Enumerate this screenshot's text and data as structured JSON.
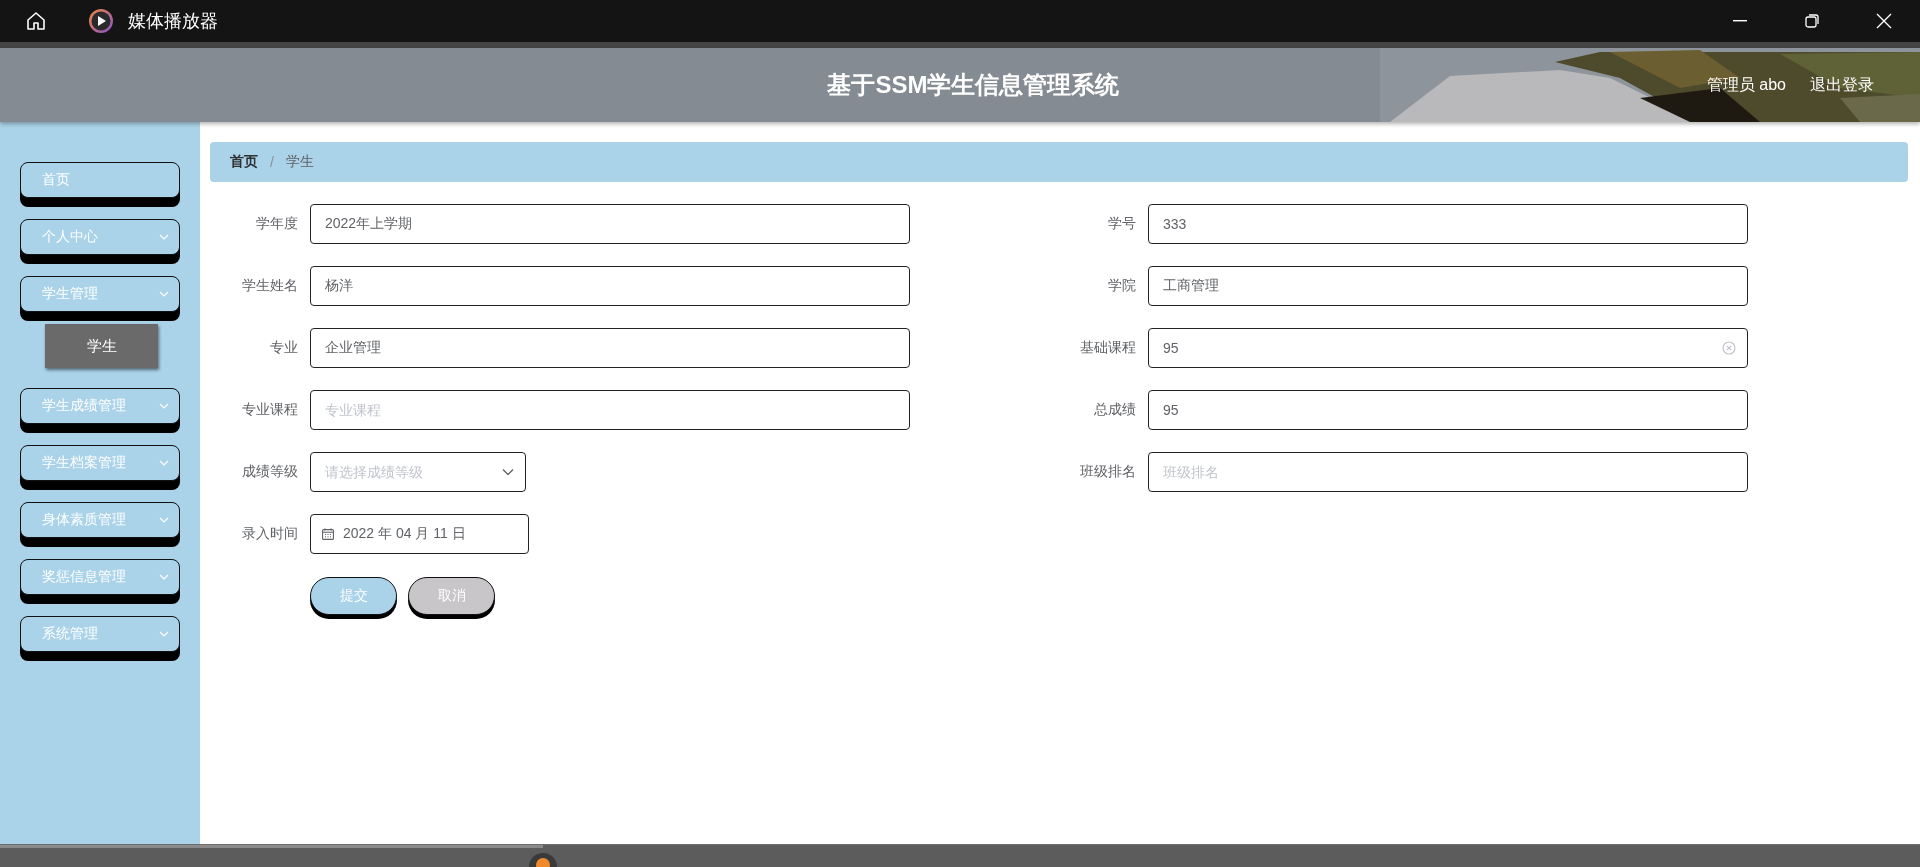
{
  "window": {
    "title": "媒体播放器"
  },
  "header": {
    "title": "基于SSM学生信息管理系统",
    "user": "管理员 abo",
    "logout": "退出登录"
  },
  "sidebar": {
    "items": [
      {
        "label": "首页",
        "kind": "link"
      },
      {
        "label": "个人中心",
        "kind": "menu"
      },
      {
        "label": "学生管理",
        "kind": "menu",
        "children": [
          {
            "label": "学生",
            "selected": true
          }
        ]
      },
      {
        "label": "学生成绩管理",
        "kind": "menu"
      },
      {
        "label": "学生档案管理",
        "kind": "menu"
      },
      {
        "label": "身体素质管理",
        "kind": "menu"
      },
      {
        "label": "奖惩信息管理",
        "kind": "menu"
      },
      {
        "label": "系统管理",
        "kind": "menu"
      }
    ]
  },
  "breadcrumb": {
    "separator": "/",
    "items": [
      {
        "label": "首页",
        "current": false
      },
      {
        "label": "学生",
        "current": true
      }
    ]
  },
  "form": {
    "left_fields": [
      {
        "label": "学年度",
        "kind": "text",
        "value": "2022年上学期",
        "clear_icon": false
      },
      {
        "label": "学生姓名",
        "kind": "text",
        "value": "杨洋",
        "clear_icon": false
      },
      {
        "label": "专业",
        "kind": "text",
        "value": "企业管理",
        "clear_icon": false
      },
      {
        "label": "专业课程",
        "kind": "text",
        "placeholder": "专业课程",
        "clear_icon": false
      },
      {
        "label": "成绩等级",
        "kind": "select",
        "placeholder": "请选择成绩等级",
        "clear_icon": false
      },
      {
        "label": "录入时间",
        "kind": "date",
        "value": "2022 年 04 月 11 日",
        "clear_icon": false
      }
    ],
    "right_fields": [
      {
        "label": "学号",
        "kind": "text",
        "value": "333",
        "clear_icon": false
      },
      {
        "label": "学院",
        "kind": "text",
        "value": "工商管理",
        "clear_icon": false
      },
      {
        "label": "基础课程",
        "kind": "text",
        "value": "95",
        "clear_icon": true
      },
      {
        "label": "总成绩",
        "kind": "text",
        "value": "95",
        "clear_icon": false
      },
      {
        "label": "班级排名",
        "kind": "text",
        "placeholder": "班级排名",
        "clear_icon": false
      }
    ],
    "buttons": [
      {
        "label": "提交",
        "kind": "primary"
      },
      {
        "label": "取消",
        "kind": "secondary"
      }
    ]
  },
  "player": {
    "level": 0.283
  }
}
